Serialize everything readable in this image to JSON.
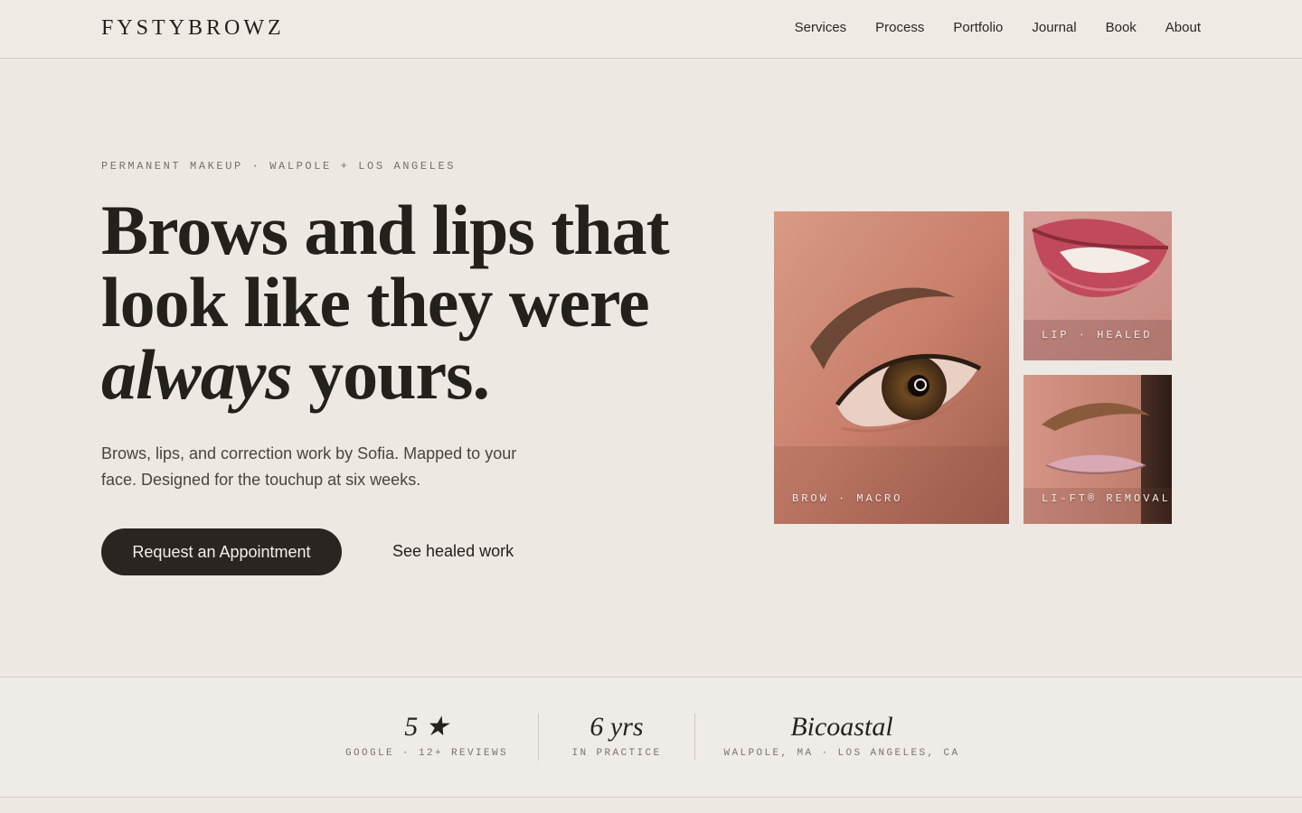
{
  "nav": {
    "logo": "FYSTYBROWZ",
    "links": [
      "Services",
      "Process",
      "Portfolio",
      "Journal",
      "Book",
      "About"
    ]
  },
  "hero": {
    "eyebrow": "PERMANENT MAKEUP · WALPOLE + LOS ANGELES",
    "headline_line1": "Brows and lips that",
    "headline_line2": "look like they were",
    "headline_emphasis": "always",
    "headline_tail": " yours.",
    "subcopy": "Brows, lips, and correction work by Sofia. Mapped to your face. Designed for the touchup at six weeks.",
    "primary_cta": "Request an Appointment",
    "secondary_cta": "See healed work"
  },
  "gallery": {
    "tiles": [
      {
        "label": "BROW · MACRO",
        "icon": "eye-closeup-photo"
      },
      {
        "label": "LIP · HEALED",
        "icon": "lips-photo"
      },
      {
        "label": "LI-FT® REMOVAL",
        "icon": "brow-closed-eye-photo"
      }
    ]
  },
  "stats": [
    {
      "value": "5 ★",
      "label": "GOOGLE · 12+ REVIEWS"
    },
    {
      "value": "6 yrs",
      "label": "IN PRACTICE"
    },
    {
      "value": "Bicoastal",
      "label": "WALPOLE, MA · LOS ANGELES, CA"
    }
  ],
  "colors": {
    "background": "#ede8e2",
    "ink": "#2a2622",
    "button": "#2a2521"
  }
}
